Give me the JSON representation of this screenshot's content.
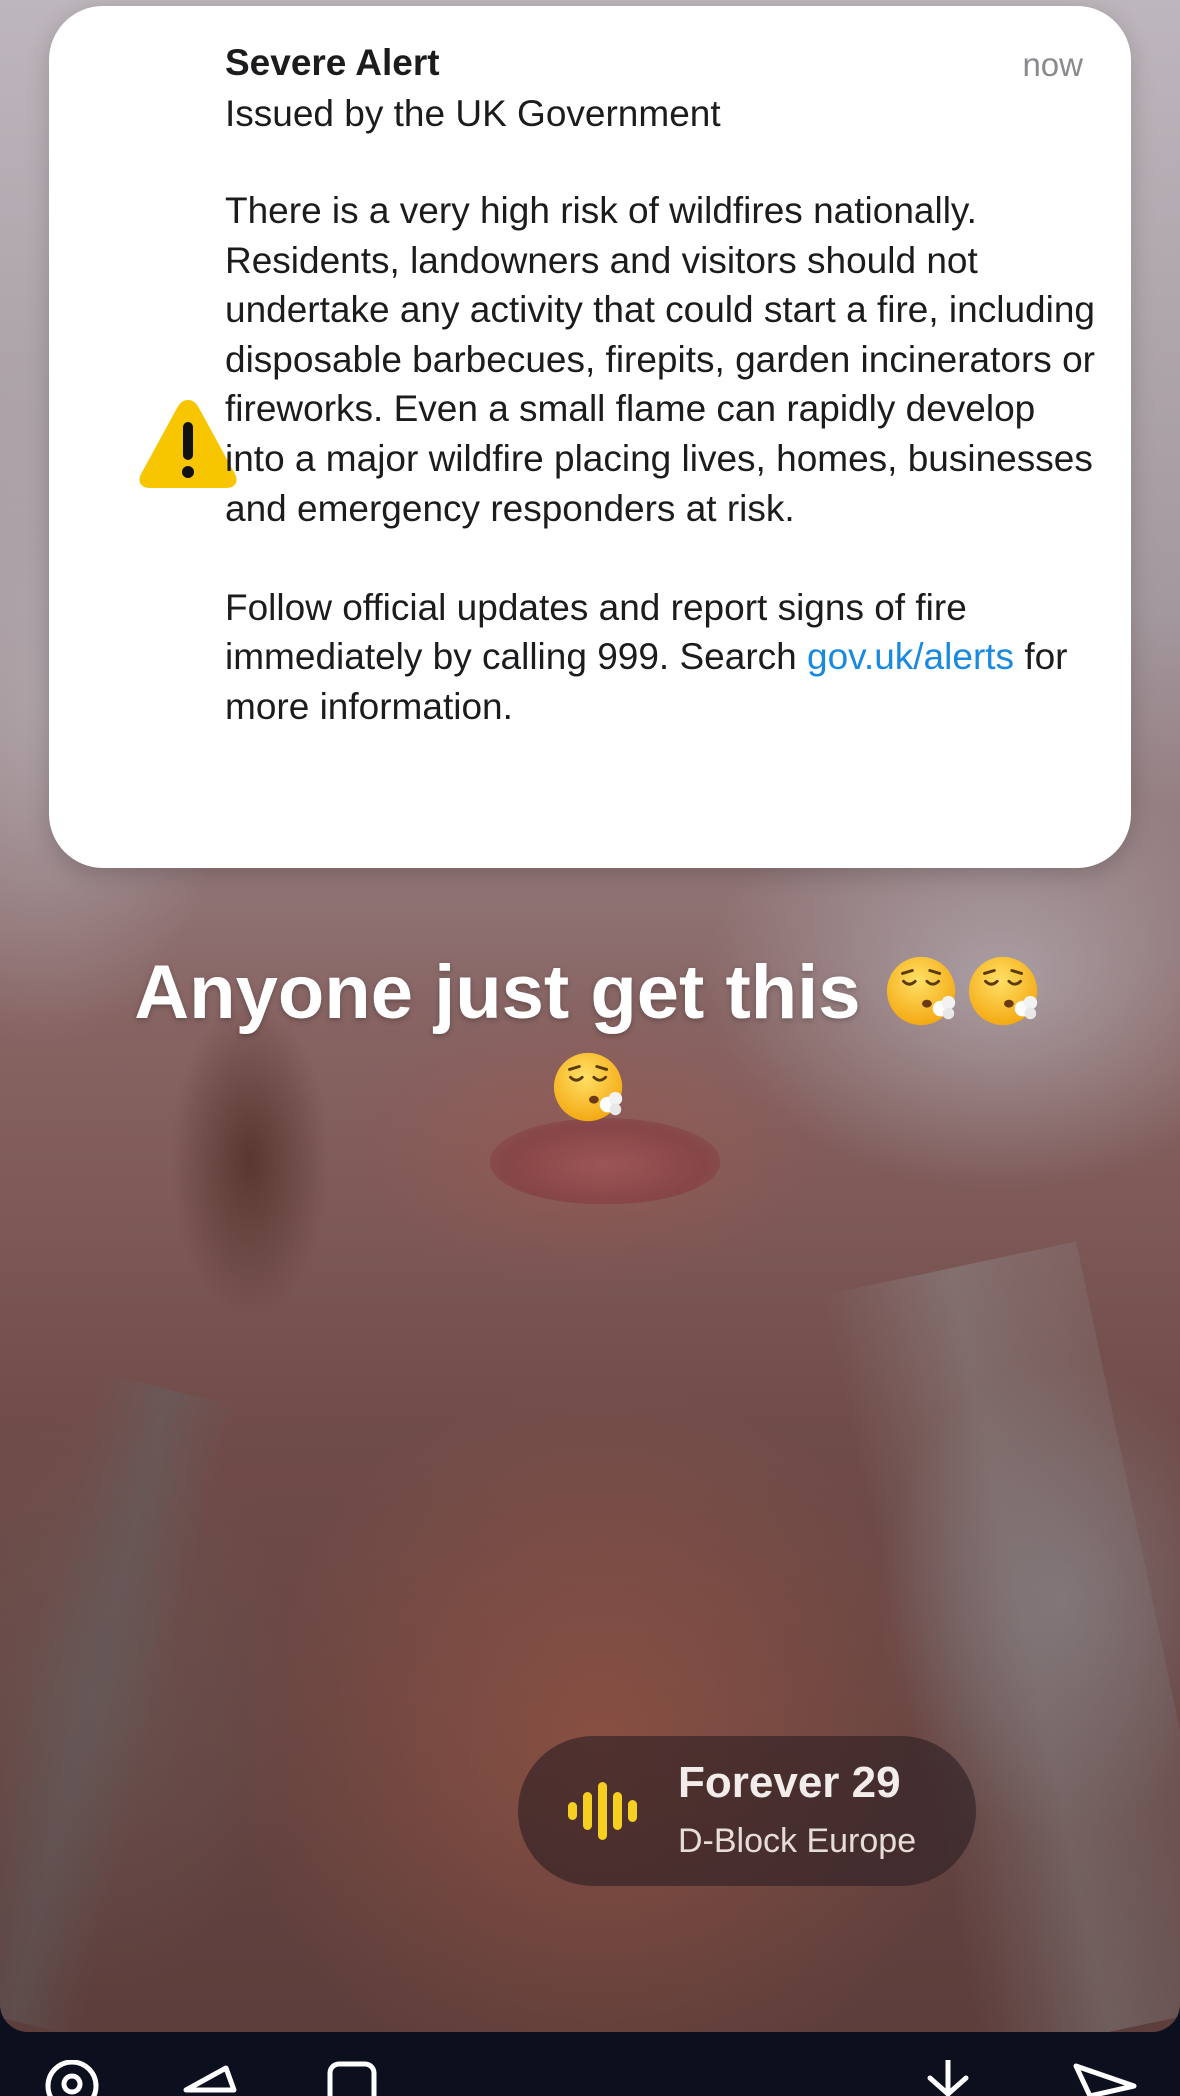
{
  "alert": {
    "title": "Severe Alert",
    "time": "now",
    "issuer": "Issued by the UK Government",
    "body_paragraph_1": "There is a very high risk of wildfires nationally. Residents, landowners and visitors should not undertake any activity that could start a fire, including disposable barbecues, firepits, garden incinerators or fireworks. Even a small flame can rapidly develop into a major wildfire placing lives, homes, businesses and emergency responders at risk.",
    "body_paragraph_2_prefix": "Follow official updates and report signs of fire immediately by calling 999. Search ",
    "link_text": "gov.uk/alerts",
    "body_paragraph_2_suffix": " for more information.",
    "icon": "warning-triangle-icon",
    "link_color": "#1a8ae0"
  },
  "caption": {
    "text": "Anyone just get this ",
    "emoji": "face-exhaling-emoji",
    "emoji_count": 3
  },
  "music": {
    "title": "Forever 29",
    "artist": "D-Block Europe",
    "icon": "sound-bars-icon",
    "accent": "#f5d020"
  },
  "nav": {
    "icons": [
      "location-icon",
      "megaphone-icon",
      "square-icon",
      "download-icon",
      "send-icon"
    ]
  }
}
